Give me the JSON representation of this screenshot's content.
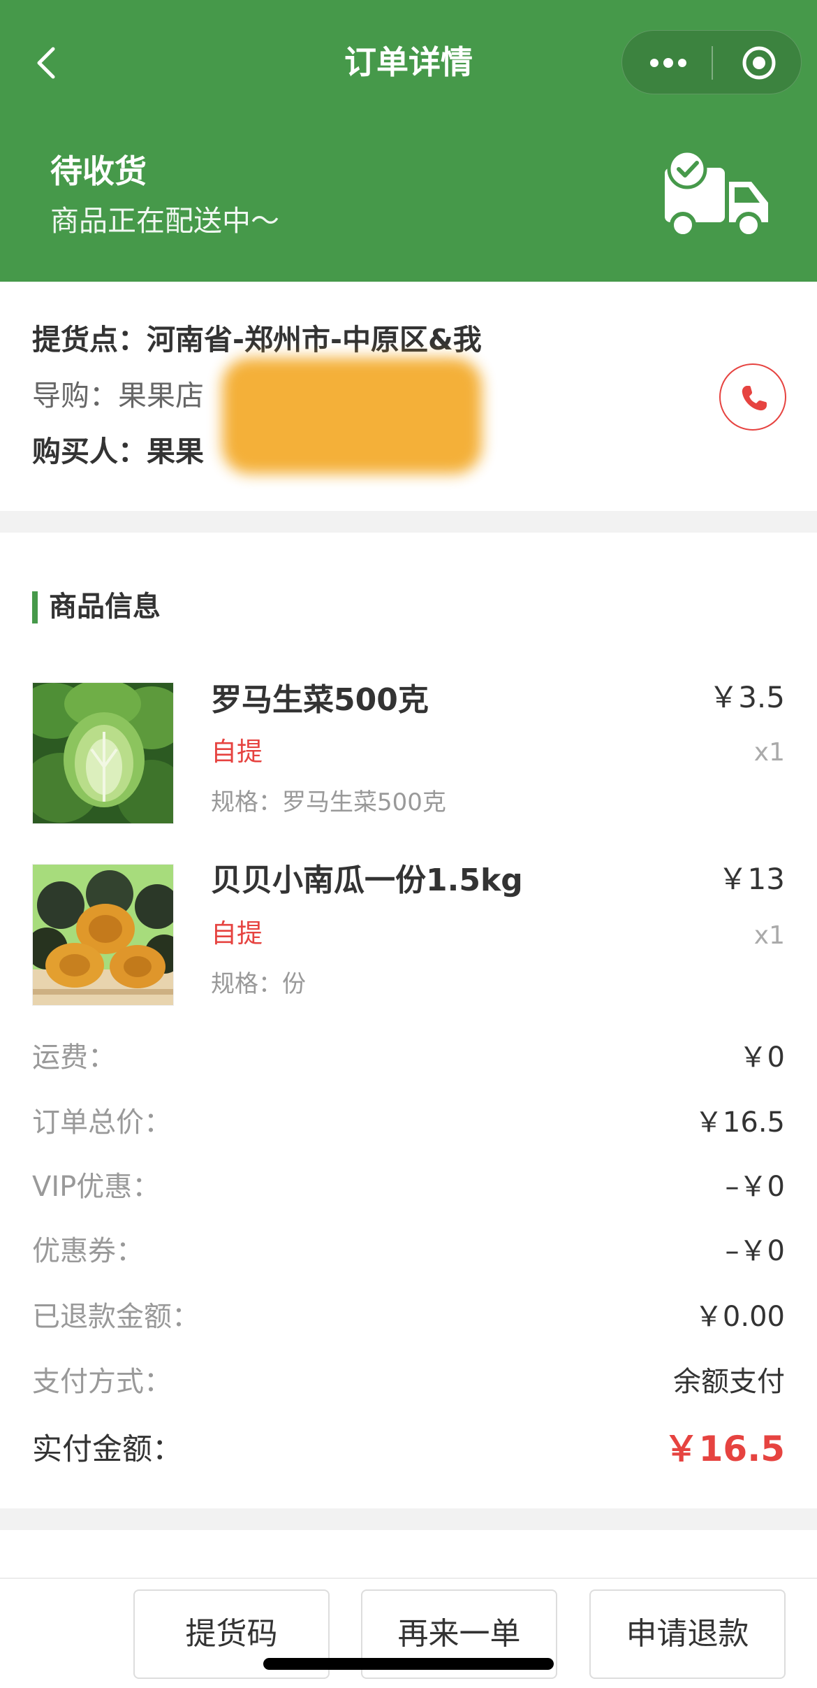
{
  "colors": {
    "primary": "#46994a",
    "accent": "#e64340"
  },
  "nav": {
    "title": "订单详情",
    "back_icon": "chevron-left-icon",
    "more_icon": "more-dots-icon",
    "close_icon": "target-circle-icon"
  },
  "status": {
    "title": "待收货",
    "subtitle": "商品正在配送中～",
    "icon": "delivery-truck-check-icon"
  },
  "pickup": {
    "point_label": "提货点：",
    "point_value": "河南省-郑州市-中原区&我",
    "guide_label": "导购：",
    "guide_value": "果果店",
    "buyer_label": "购买人：",
    "buyer_value": "果果",
    "phone_icon": "phone-icon"
  },
  "products_section": {
    "title": "商品信息"
  },
  "products": [
    {
      "name": "罗马生菜500克",
      "delivery": "自提",
      "spec_label": "规格：",
      "spec": "罗马生菜500克",
      "price": "￥3.5",
      "qty": "x1",
      "image": "romaine-lettuce-image"
    },
    {
      "name": "贝贝小南瓜一份1.5kg",
      "delivery": "自提",
      "spec_label": "规格：",
      "spec": "份",
      "price": "￥13",
      "qty": "x1",
      "image": "baby-pumpkin-image"
    }
  ],
  "summary": [
    {
      "label": "运费：",
      "value": "￥0"
    },
    {
      "label": "订单总价：",
      "value": "￥16.5"
    },
    {
      "label": "VIP优惠：",
      "value": "–￥0"
    },
    {
      "label": "优惠券：",
      "value": "–￥0"
    },
    {
      "label": "已退款金额：",
      "value": "￥0.00"
    },
    {
      "label": "支付方式：",
      "value": "余额支付"
    }
  ],
  "total": {
    "label": "实付金额：",
    "value": "￥16.5"
  },
  "actions": [
    "提货码",
    "再来一单",
    "申请退款"
  ]
}
